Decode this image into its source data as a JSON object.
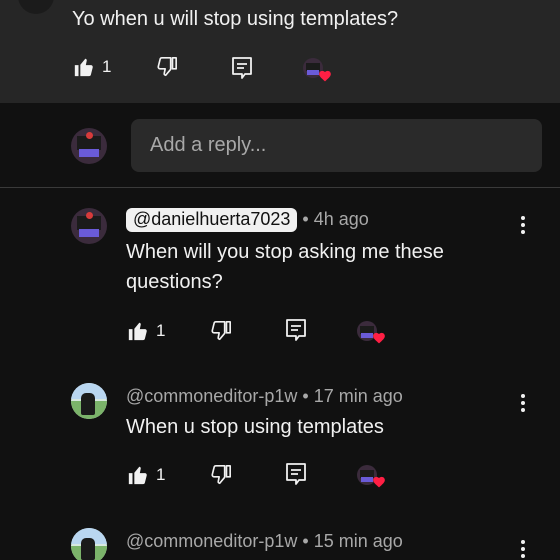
{
  "top_comment": {
    "text": "Yo when u will stop using templates?",
    "like_count": "1"
  },
  "reply_box": {
    "placeholder": "Add a reply..."
  },
  "replies": [
    {
      "handle": "@danielhuerta7023",
      "time": "4h ago",
      "text_line1": "When will you stop asking me these",
      "text_line2": "questions?",
      "like_count": "1"
    },
    {
      "handle": "@commoneditor-p1w",
      "time": "17 min ago",
      "text": "When u stop using templates",
      "like_count": "1"
    },
    {
      "handle": "@commoneditor-p1w",
      "time": "15 min ago"
    }
  ],
  "separator": "•",
  "icons": {
    "like": "thumbs-up-icon",
    "dislike": "thumbs-down-icon",
    "reply": "comment-icon",
    "creator_heart": "heart-icon",
    "more": "more-vert-icon"
  },
  "colors": {
    "background": "#111111",
    "top_block": "#262626",
    "heart": "#ff1f44",
    "muted_text": "#a8a8a8"
  }
}
